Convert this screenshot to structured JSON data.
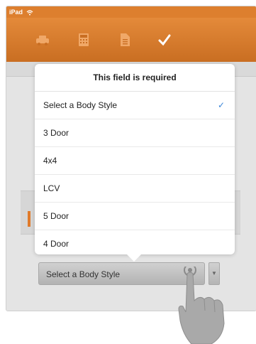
{
  "statusbar": {
    "device_label": "iPad"
  },
  "popover": {
    "title": "This field is required",
    "options": [
      {
        "label": "Select a Body Style",
        "selected": true
      },
      {
        "label": "3 Door",
        "selected": false
      },
      {
        "label": "4x4",
        "selected": false
      },
      {
        "label": "LCV",
        "selected": false
      },
      {
        "label": "5 Door",
        "selected": false
      },
      {
        "label": "4 Door",
        "selected": false
      }
    ]
  },
  "select": {
    "value": "Select a Body Style"
  },
  "icons": {
    "toolbar": [
      "car-icon",
      "calculator-icon",
      "document-icon",
      "checkmark-icon"
    ],
    "check": "✓",
    "dropdown": "▼"
  },
  "colors": {
    "toolbar": "#dd7f2e",
    "check": "#3b86d8"
  }
}
